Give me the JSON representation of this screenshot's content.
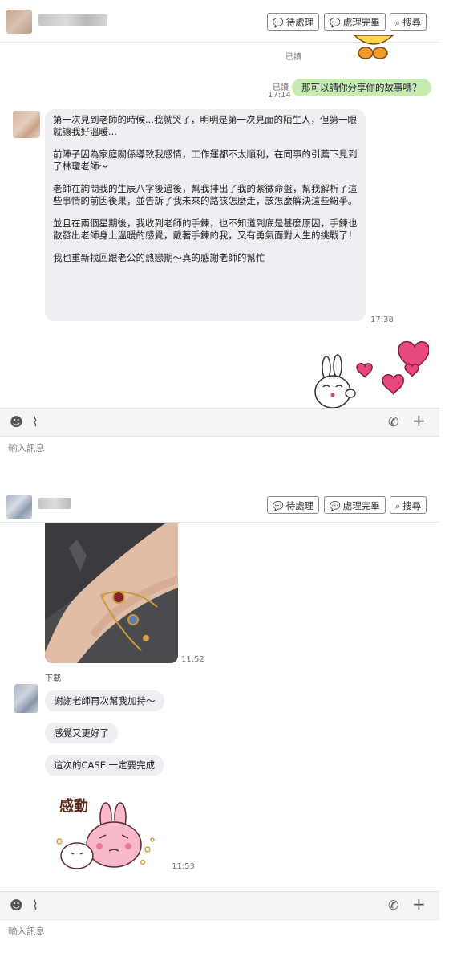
{
  "header": {
    "pending_label": "待處理",
    "done_label": "處理完畢",
    "search_label": "搜尋"
  },
  "chat1": {
    "read_status_top": "已讀",
    "outgoing": {
      "read": "已讀",
      "time": "17:14",
      "text": "那可以請你分享你的故事嗎？"
    },
    "story": {
      "paragraphs": [
        "第一次見到老師的時候...我就哭了，明明是第一次見面的陌生人，但第一眼就讓我好溫暖...",
        "前陣子因為家庭關係導致我感情，工作運都不太順利，在同事的引薦下見到了林瓊老師～",
        "老師在詢問我的生辰八字後過後，幫我排出了我的紫微命盤，幫我解析了這些事情的前因後果，並告訴了我未來的路該怎麼走，該怎麼解決這些紛爭。",
        "並且在兩個星期後，我收到老師的手鍊，也不知道到底是甚麼原因，手鍊也散發出老師身上溫暖的感覺，戴著手鍊的我，又有勇氣面對人生的挑戰了！",
        "我也重新找回跟老公的熱戀期～真的感謝老師的幫忙"
      ],
      "time": "17:38"
    },
    "input_placeholder": "輸入訊息"
  },
  "chat2": {
    "photo_time": "11:52",
    "download_label": "下載",
    "messages": [
      "謝謝老師再次幫我加持～",
      "感覺又更好了",
      "這次的CASE 一定要完成"
    ],
    "sticker_text": "感動",
    "sticker_time": "11:53",
    "input_placeholder": "輸入訊息"
  },
  "colors": {
    "outgoing_bubble": "#c7ecb1",
    "incoming_bubble": "#edeff2",
    "heart": "#e8497c"
  },
  "icons": {
    "pending": "chat-bubble-icon",
    "done": "chat-bubble-icon",
    "search": "search-icon",
    "emoji": "smiley-icon",
    "attach": "paperclip-icon",
    "voice": "phone-bubble-icon",
    "add": "plus-icon"
  }
}
